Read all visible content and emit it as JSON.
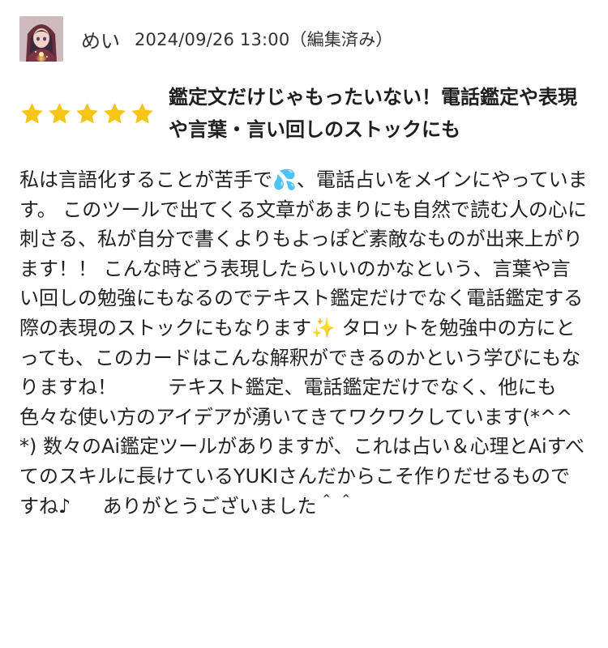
{
  "review": {
    "reviewer_name": "めい",
    "date": "2024/09/26 13:00（編集済み）",
    "rating": 5,
    "rating_max": 5,
    "star_color": "#F5C518",
    "avatar_icon": "witch-avatar-icon",
    "title": "鑑定文だけじゃもったいない！電話鑑定や表現や言葉・言い回しのストックにも",
    "body": "私は言語化することが苦手で💦、電話占いをメインにやっています。 このツールで出てくる文章があまりにも自然で読む人の心に刺さる、私が自分で書くよりもよっぽど素敵なものが出来上がります！！ こんな時どう表現したらいいのかなという、言葉や言い回しの勉強にもなるのでテキスト鑑定だけでなく電話鑑定する際の表現のストックにもなります✨ タロットを勉強中の方にとっても、このカードはこんな解釈ができるのかという学びにもなりますね！ 　　 テキスト鑑定、電話鑑定だけでなく、他にも色々な使い方のアイデアが湧いてきてワクワクしています(*^^*) 数々のAi鑑定ツールがありますが、これは占い＆心理とAiすべてのスキルに長けているYUKIさんだからこそ作りだせるものですね♪ 　 ありがとうございました＾＾"
  }
}
